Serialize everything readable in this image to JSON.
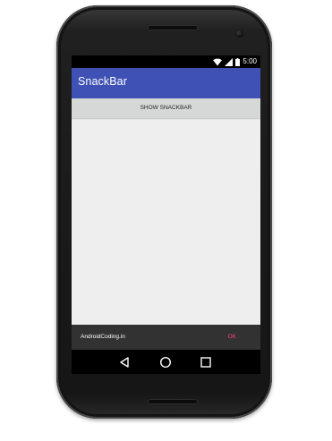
{
  "status_bar": {
    "time": "5:00",
    "icons": [
      "wifi-icon",
      "signal-icon",
      "battery-icon"
    ]
  },
  "app_bar": {
    "title": "SnackBar",
    "color": "#3f51b5"
  },
  "main": {
    "show_button_label": "SHOW SNACKBAR"
  },
  "snackbar": {
    "message": "AndroidCoding.in",
    "action_label": "OK",
    "action_color": "#ff4081",
    "background": "#323232"
  },
  "nav_bar": {
    "icons": [
      "back-icon",
      "home-icon",
      "recents-icon"
    ]
  }
}
